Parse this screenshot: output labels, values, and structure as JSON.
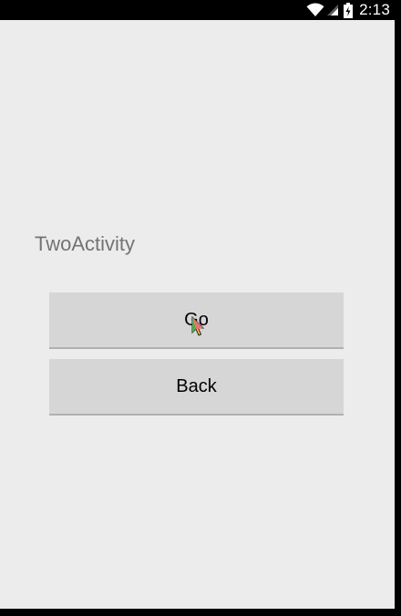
{
  "status_bar": {
    "time": "2:13",
    "icons": [
      "wifi-icon",
      "signal-icon",
      "battery-icon"
    ]
  },
  "activity": {
    "title": "TwoActivity"
  },
  "buttons": {
    "go_label": "Go",
    "back_label": "Back"
  },
  "colors": {
    "background": "#ececec",
    "button": "#d6d6d6",
    "title_text": "#737373"
  }
}
